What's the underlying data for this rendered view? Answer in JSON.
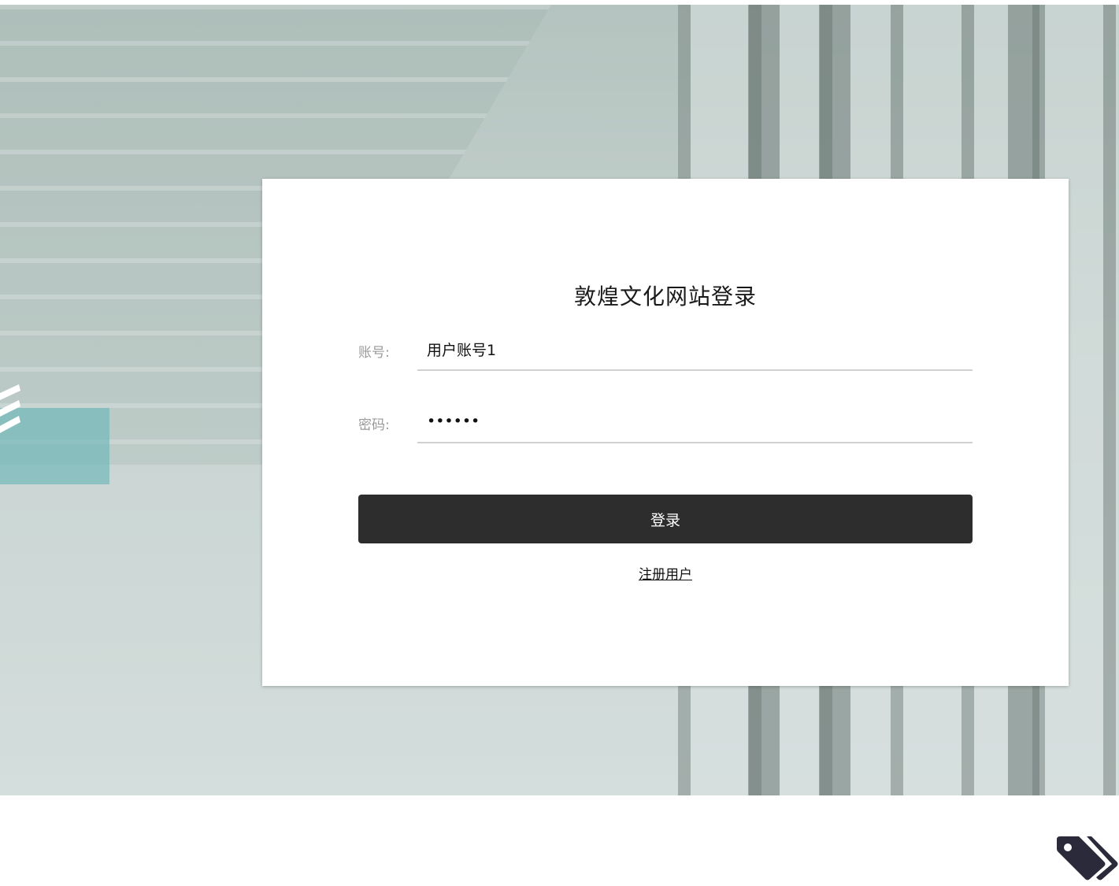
{
  "login": {
    "title": "敦煌文化网站登录",
    "account_label": "账号:",
    "account_value": "用户账号1",
    "password_label": "密码:",
    "password_value": "••••••",
    "login_button": "登录",
    "register_link": "注册用户"
  },
  "colors": {
    "button_bg": "#2d2d2d",
    "card_bg": "#ffffff",
    "teal_accent": "#78b9bc",
    "tag_icon": "#2a2a3a"
  },
  "icons": {
    "corner": "tags-icon"
  }
}
